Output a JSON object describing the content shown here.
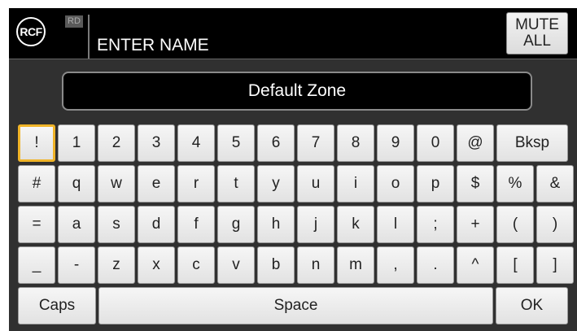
{
  "header": {
    "logo_text": "RCF",
    "badge": "RD",
    "title": "ENTER NAME",
    "mute_line1": "MUTE",
    "mute_line2": "ALL"
  },
  "name_field": {
    "value": "Default Zone"
  },
  "keyboard": {
    "selected_key": "!",
    "rows": [
      [
        "!",
        "1",
        "2",
        "3",
        "4",
        "5",
        "6",
        "7",
        "8",
        "9",
        "0",
        "@",
        "Bksp"
      ],
      [
        "#",
        "q",
        "w",
        "e",
        "r",
        "t",
        "y",
        "u",
        "i",
        "o",
        "p",
        "$",
        "%",
        "&"
      ],
      [
        "=",
        "a",
        "s",
        "d",
        "f",
        "g",
        "h",
        "j",
        "k",
        "l",
        ";",
        "+",
        "(",
        ")"
      ],
      [
        "_",
        "-",
        "z",
        "x",
        "c",
        "v",
        "b",
        "n",
        "m",
        ",",
        ".",
        "^",
        "[",
        "]"
      ],
      [
        "Caps",
        "Space",
        "OK"
      ]
    ]
  }
}
